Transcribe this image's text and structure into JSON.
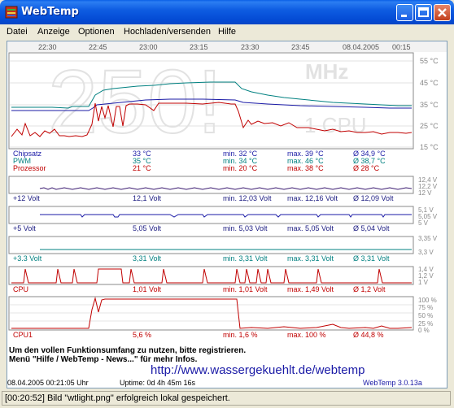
{
  "window": {
    "title": "WebTemp"
  },
  "menu": [
    "Datei",
    "Anzeige",
    "Optionen",
    "Hochladen/versenden",
    "Hilfe"
  ],
  "time_axis": [
    "22:30",
    "22:45",
    "23:00",
    "23:15",
    "23:30",
    "23:45",
    "08.04.2005",
    "00:15"
  ],
  "big_display": {
    "value": "250!",
    "unit": "MHz",
    "label": "1 CPU"
  },
  "temp_scale": [
    "55 °C",
    "45 °C",
    "35 °C",
    "25 °C",
    "15 °C"
  ],
  "colors": {
    "chipsatz": "#1a1aa6",
    "pwm": "#008080",
    "prozessor": "#c00000",
    "cpu": "#c00000",
    "volt": "#1a1a80",
    "teal": "#008080"
  },
  "temps": [
    {
      "name": "Chipsatz",
      "cur": "33 °C",
      "min": "min. 32 °C",
      "max": "max. 39 °C",
      "avg": "Ø 34,9 °C"
    },
    {
      "name": "PWM",
      "cur": "35 °C",
      "min": "min. 34 °C",
      "max": "max. 46 °C",
      "avg": "Ø 38,7 °C"
    },
    {
      "name": "Prozessor",
      "cur": "21 °C",
      "min": "min. 20 °C",
      "max": "max. 38 °C",
      "avg": "Ø 28 °C"
    }
  ],
  "volt12": {
    "name": "+12 Volt",
    "cur": "12,1 Volt",
    "min": "min. 12,03 Volt",
    "max": "max. 12,16 Volt",
    "avg": "Ø 12,09 Volt",
    "scale": [
      "12,4 V",
      "12,2 V",
      "12 V"
    ]
  },
  "volt5": {
    "name": "+5 Volt",
    "cur": "5,05 Volt",
    "min": "min. 5,03 Volt",
    "max": "max. 5,05 Volt",
    "avg": "Ø 5,04 Volt",
    "scale": [
      "5,1 V",
      "5,05 V",
      "5 V"
    ]
  },
  "volt33": {
    "name": "+3.3 Volt",
    "cur": "3,31 Volt",
    "min": "min. 3,31 Volt",
    "max": "max. 3,31 Volt",
    "avg": "Ø 3,31 Volt",
    "scale": [
      "3,35 V",
      "3,3 V"
    ]
  },
  "cpu": {
    "name": "CPU",
    "cur": "1,01 Volt",
    "min": "min. 1,01 Volt",
    "max": "max. 1,49 Volt",
    "avg": "Ø 1,2 Volt",
    "scale": [
      "1,4 V",
      "1,2 V",
      "1 V"
    ]
  },
  "cpu1": {
    "name": "CPU1",
    "cur": "5,6 %",
    "min": "min. 1,6 %",
    "max": "max. 100 %",
    "avg": "Ø 44,8 %",
    "scale": [
      "100 %",
      "75 %",
      "50 %",
      "25 %",
      "0 %"
    ]
  },
  "notice": {
    "line1": "Um den vollen Funktionsumfang zu nutzen, bitte registrieren.",
    "line2": "Menü \"Hilfe / WebTemp - News...\" für mehr Infos."
  },
  "url": "http://www.wassergekuehlt.de/webtemp",
  "footer": {
    "datetime": "08.04.2005 00:21:05 Uhr",
    "uptime": "Uptime: 0d 4h 45m 16s",
    "version": "WebTemp 3.0.13a"
  },
  "statusbar": "[00:20:52] Bild \"wtlight.png\" erfolgreich lokal gespeichert."
}
